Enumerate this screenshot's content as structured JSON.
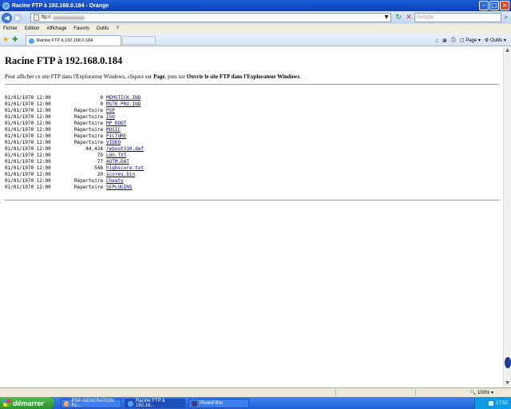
{
  "window": {
    "title": "Racine FTP à 192.168.0.184 - Orange",
    "controls": [
      "minimize",
      "maximize",
      "close"
    ]
  },
  "address_bar": {
    "url": "ftp://",
    "search_placeholder": "Google"
  },
  "menu": [
    "Fichier",
    "Edition",
    "Affichage",
    "Favoris",
    "Outils",
    "?"
  ],
  "tabs": [
    {
      "label": "Racine FTP à 192.168.0.184"
    }
  ],
  "toolbar": {
    "page_label": "Page",
    "tools_label": "Outils"
  },
  "page": {
    "heading": "Racine FTP à 192.168.0.184",
    "info_prefix": "Pour afficher ce site FTP dans l'Explorateur Windows, cliquez sur ",
    "info_page": "Page",
    "info_middle": ", puis sur ",
    "info_open": "Ouvrir le site FTP dans l'Explorateur Windows",
    "info_suffix": ".",
    "entries": [
      {
        "date": "01/01/1970 12:00",
        "size": "0",
        "name": "MEMSTICK.IND"
      },
      {
        "date": "01/01/1970 12:00",
        "size": "0",
        "name": "MSTK_PRO.IND"
      },
      {
        "date": "01/01/1970 12:00",
        "size": "Répertoire",
        "name": "PSP"
      },
      {
        "date": "01/01/1970 12:00",
        "size": "Répertoire",
        "name": "ISO"
      },
      {
        "date": "01/01/1970 12:00",
        "size": "Répertoire",
        "name": "MP_ROOT"
      },
      {
        "date": "01/01/1970 12:00",
        "size": "Répertoire",
        "name": "MUSIC"
      },
      {
        "date": "01/01/1970 12:00",
        "size": "Répertoire",
        "name": "PICTURE"
      },
      {
        "date": "01/01/1970 12:00",
        "size": "Répertoire",
        "name": "VIDEO"
      },
      {
        "date": "01/01/1970 12:00",
        "size": "44,424",
        "name": "reboot310.def"
      },
      {
        "date": "01/01/1970 12:00",
        "size": "79",
        "name": "LOG.TXT"
      },
      {
        "date": "01/01/1970 12:00",
        "size": "77",
        "name": "AOTM.DAT"
      },
      {
        "date": "01/01/1970 12:00",
        "size": "548",
        "name": "highscore.txt"
      },
      {
        "date": "01/01/1970 12:00",
        "size": "20",
        "name": "scores.bin"
      },
      {
        "date": "01/01/1970 12:00",
        "size": "Répertoire",
        "name": "Cheats"
      },
      {
        "date": "01/01/1970 12:00",
        "size": "Répertoire",
        "name": "SEPLUGINS"
      }
    ]
  },
  "statusbar": {
    "zoom": "100%"
  },
  "taskbar": {
    "start_label": "démarrer",
    "tasks": [
      {
        "label": "PSP-GENERATION Fo..."
      },
      {
        "label": "Racine FTP à 192.16..."
      },
      {
        "label": "PhotoFiltre"
      }
    ],
    "clock": "17:52"
  }
}
